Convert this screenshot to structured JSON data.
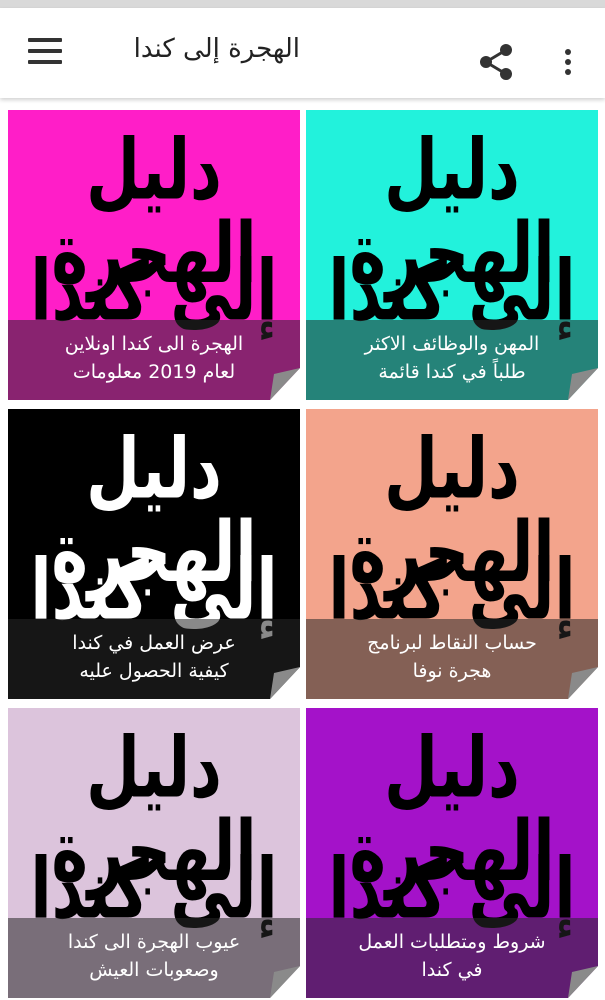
{
  "app": {
    "title": "الهجرة إلى كندا",
    "icons": {
      "menu": "hamburger-menu-icon",
      "share": "share-icon",
      "more": "more-vert-icon"
    }
  },
  "tiles": [
    {
      "art_line1": "دليل الهجرة",
      "art_line2": "إلى كندا",
      "caption_line1": "المهن والوظائف الاكثر",
      "caption_line2": "طلباً في كندا قائمة",
      "bg": "#22f2dc",
      "art_color": "#000000"
    },
    {
      "art_line1": "دليل الهجرة",
      "art_line2": "إلى كندا",
      "caption_line1": "الهجرة الى كندا اونلاين",
      "caption_line2": "لعام 2019 معلومات",
      "bg": "#ff1ec8",
      "art_color": "#000000"
    },
    {
      "art_line1": "دليل الهجرة",
      "art_line2": "إلى كندا",
      "caption_line1": "حساب النقاط لبرنامج",
      "caption_line2": "هجرة نوفا",
      "bg": "#f3a48c",
      "art_color": "#000000"
    },
    {
      "art_line1": "دليل الهجرة",
      "art_line2": "إلى كندا",
      "caption_line1": "عرض العمل في كندا",
      "caption_line2": "كيفية الحصول عليه",
      "bg": "#000000",
      "art_color": "#ffffff"
    },
    {
      "art_line1": "دليل الهجرة",
      "art_line2": "إلى كندا",
      "caption_line1": "شروط ومتطلبات العمل",
      "caption_line2": "في كندا",
      "bg": "#a412c9",
      "art_color": "#000000"
    },
    {
      "art_line1": "دليل الهجرة",
      "art_line2": "إلى كندا",
      "caption_line1": "عيوب الهجرة الى كندا",
      "caption_line2": "وصعوبات العيش",
      "bg": "#dcc4dc",
      "art_color": "#000000"
    }
  ]
}
